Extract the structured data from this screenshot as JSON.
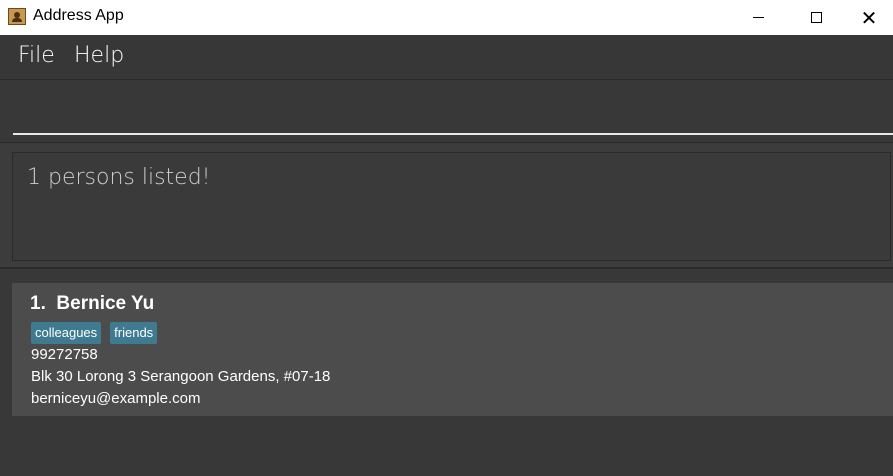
{
  "window": {
    "title": "Address App",
    "close_glyph": "✕"
  },
  "menu": {
    "file": "File",
    "help": "Help"
  },
  "command": {
    "value": "",
    "placeholder": ""
  },
  "result": {
    "message": "1 persons listed!"
  },
  "persons": [
    {
      "index": "1.",
      "name": "Bernice Yu",
      "tags": [
        "colleagues",
        "friends"
      ],
      "phone": "99272758",
      "address": "Blk 30 Lorong 3 Serangoon Gardens, #07-18",
      "email": "berniceyu@example.com"
    }
  ],
  "colors": {
    "background": "#3c3c3c",
    "card": "#4c4c4c",
    "tag": "#3e7b91",
    "text": "#ffffff"
  },
  "icons": {
    "app": "address-book-icon",
    "minimize": "minimize-icon",
    "maximize": "maximize-icon",
    "close": "close-icon"
  }
}
